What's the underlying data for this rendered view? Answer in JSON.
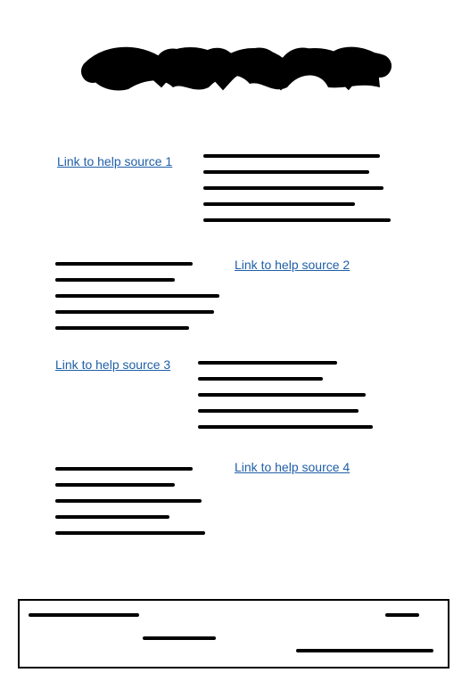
{
  "header": {
    "logo_icon": "scribble-logo-icon"
  },
  "links": [
    {
      "label": "Link to help source 1"
    },
    {
      "label": "Link to help source 2"
    },
    {
      "label": "Link to help source 3"
    },
    {
      "label": "Link to help source 4"
    }
  ],
  "colors": {
    "link": "#1f5fa7",
    "ink": "#000000",
    "background": "#ffffff"
  }
}
